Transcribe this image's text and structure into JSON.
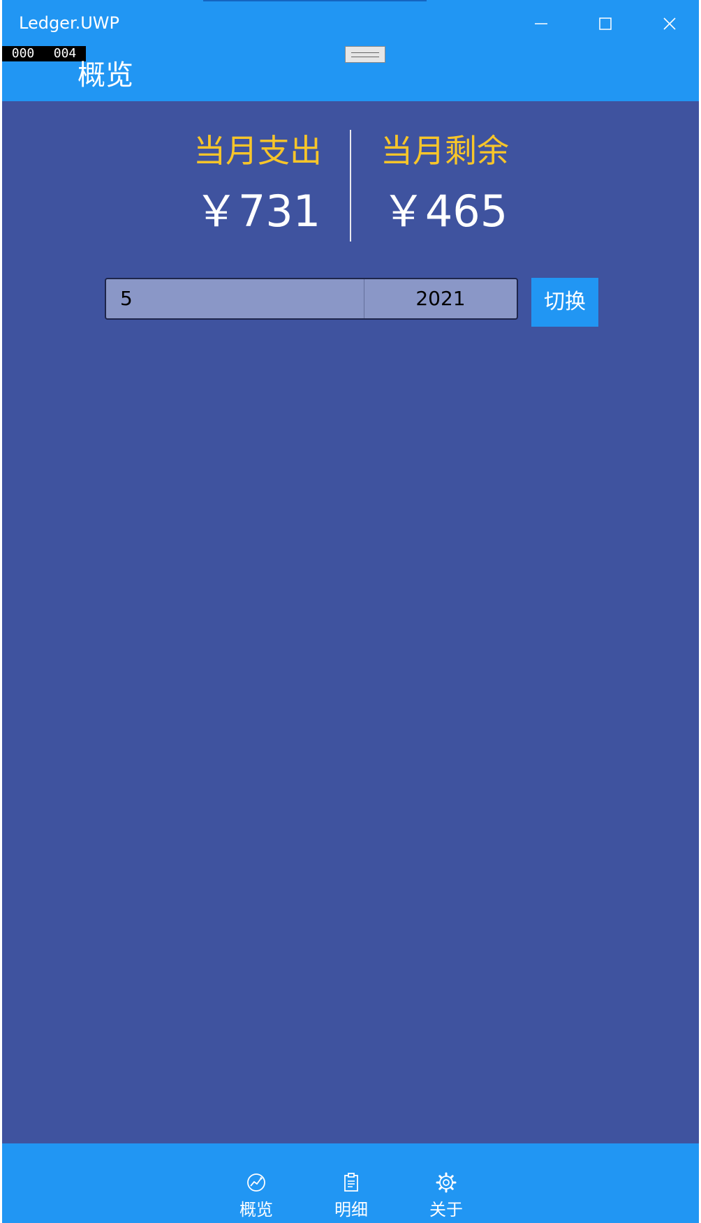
{
  "window": {
    "title": "Ledger.UWP",
    "counter_left": "000",
    "counter_right": "004"
  },
  "header": {
    "page_title": "概览"
  },
  "summary": {
    "expense_label": "当月支出",
    "expense_value": "￥731",
    "remaining_label": "当月剩余",
    "remaining_value": "￥465"
  },
  "picker": {
    "month": "5",
    "year": "2021",
    "switch_label": "切换"
  },
  "nav": {
    "items": [
      {
        "label": "概览",
        "icon": "dashboard-icon"
      },
      {
        "label": "明细",
        "icon": "clipboard-icon"
      },
      {
        "label": "关于",
        "icon": "gear-icon"
      }
    ]
  },
  "colors": {
    "accent": "#2196f3",
    "background": "#3f539f",
    "label": "#f7c52a",
    "picker": "#8a97c7"
  }
}
